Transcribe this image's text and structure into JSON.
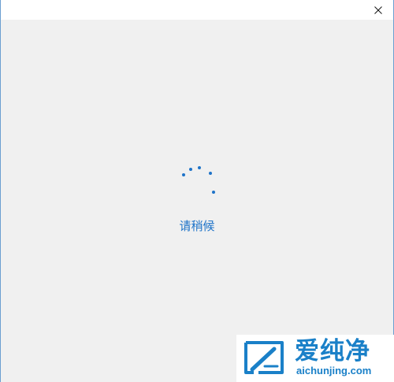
{
  "window": {
    "close_icon": "close-icon"
  },
  "loading": {
    "spinner_icon": "loading-spinner-icon",
    "status_text": "请稍候",
    "accent_color": "#1e73c8"
  },
  "watermark": {
    "brand": "爱纯净",
    "url": "aichunjing.com",
    "color": "#1a80c8"
  }
}
